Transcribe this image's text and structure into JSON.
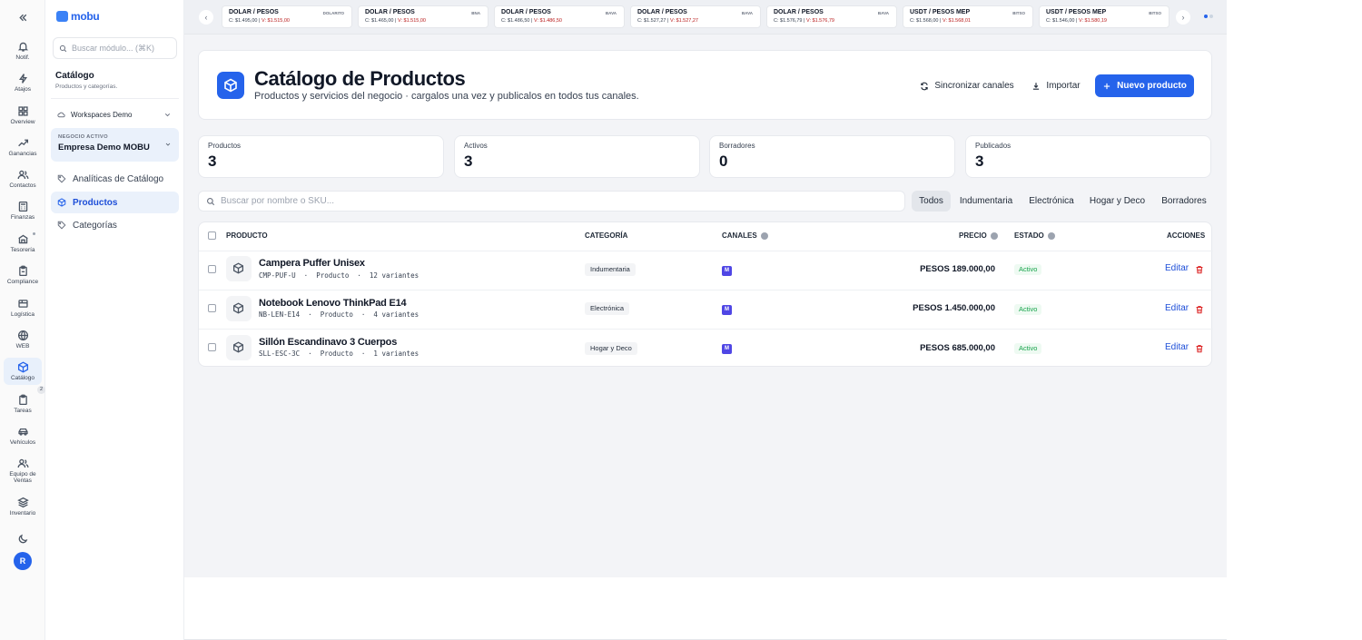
{
  "rail": {
    "collapse_icon": "chevrons-left-icon",
    "items": [
      {
        "label": "Notif.",
        "icon": "bell-icon"
      },
      {
        "label": "Atajos",
        "icon": "zap-icon"
      },
      {
        "label": "Overview",
        "icon": "grid-icon"
      },
      {
        "label": "Ganancias",
        "icon": "trending-up-icon"
      },
      {
        "label": "Contactos",
        "icon": "users-icon"
      },
      {
        "label": "Finanzas",
        "icon": "calculator-icon"
      },
      {
        "label": "Tesorería",
        "icon": "vault-icon"
      },
      {
        "label": "Compliance",
        "icon": "clipboard-icon"
      },
      {
        "label": "Logística",
        "icon": "package-icon"
      },
      {
        "label": "WEB",
        "icon": "globe-icon"
      },
      {
        "label": "Catálogo",
        "icon": "box-icon"
      },
      {
        "label": "Tareas",
        "icon": "clipboard-list-icon"
      },
      {
        "label": "Vehículos",
        "icon": "car-icon"
      },
      {
        "label": "Equipo de Ventas",
        "icon": "team-icon"
      },
      {
        "label": "Inventario",
        "icon": "layers-icon"
      }
    ],
    "catalog_badge": "2",
    "avatar_initial": "R"
  },
  "sidebar": {
    "brand": "mobu",
    "search_placeholder": "Buscar módulo... (⌘K)",
    "title": "Catálogo",
    "subtitle": "Productos y categorías.",
    "workspace": "Workspaces Demo",
    "business_label": "NEGOCIO ACTIVO",
    "business_name": "Empresa Demo MOBU",
    "nav": [
      {
        "label": "Analíticas de Catálogo",
        "icon": "tag-icon"
      },
      {
        "label": "Productos",
        "icon": "box-icon"
      },
      {
        "label": "Categorías",
        "icon": "tag-icon"
      }
    ]
  },
  "ticker": [
    {
      "pair": "DOLAR / PESOS",
      "source": "DOLARITO",
      "buy": "C: $1.495,00",
      "sell": "V: $1.515,00"
    },
    {
      "pair": "DOLAR / PESOS",
      "source": "BNA",
      "buy": "C: $1.465,00",
      "sell": "V: $1.515,00"
    },
    {
      "pair": "DOLAR / PESOS",
      "source": "BAVA",
      "buy": "C: $1.486,50",
      "sell": "V: $1.486,50"
    },
    {
      "pair": "DOLAR / PESOS",
      "source": "BAVA",
      "buy": "C: $1.527,27",
      "sell": "V: $1.527,27"
    },
    {
      "pair": "DOLAR / PESOS",
      "source": "BAVA",
      "buy": "C: $1.576,79",
      "sell": "V: $1.576,79"
    },
    {
      "pair": "USDT / PESOS MEP",
      "source": "BITSO",
      "buy": "C: $1.568,00",
      "sell": "V: $1.568,01"
    },
    {
      "pair": "USDT / PESOS MEP",
      "source": "BITSO",
      "buy": "C: $1.546,00",
      "sell": "V: $1.580,19"
    }
  ],
  "header": {
    "title": "Catálogo de Productos",
    "subtitle": "Productos y servicios del negocio · cargalos una vez y publicalos en todos tus canales.",
    "sync_label": "Sincronizar canales",
    "import_label": "Importar",
    "new_label": "Nuevo producto"
  },
  "stats": [
    {
      "label": "Productos",
      "value": "3"
    },
    {
      "label": "Activos",
      "value": "3"
    },
    {
      "label": "Borradores",
      "value": "0"
    },
    {
      "label": "Publicados",
      "value": "3"
    }
  ],
  "search": {
    "placeholder": "Buscar por nombre o SKU..."
  },
  "filters": [
    "Todos",
    "Indumentaria",
    "Electrónica",
    "Hogar y Deco",
    "Borradores"
  ],
  "table": {
    "columns": {
      "product": "PRODUCTO",
      "category": "CATEGORÍA",
      "channels": "CANALES",
      "price": "PRECIO",
      "status": "ESTADO",
      "actions": "ACCIONES"
    },
    "rows": [
      {
        "name": "Campera Puffer Unisex",
        "meta": "CMP-PUF-U  ·  Producto  ·  12 variantes",
        "category": "Indumentaria",
        "channel": "M",
        "price": "PESOS 189.000,00",
        "status": "Activo",
        "edit": "Editar"
      },
      {
        "name": "Notebook Lenovo ThinkPad E14",
        "meta": "NB-LEN-E14  ·  Producto  ·  4 variantes",
        "category": "Electrónica",
        "channel": "M",
        "price": "PESOS 1.450.000,00",
        "status": "Activo",
        "edit": "Editar"
      },
      {
        "name": "Sillón Escandinavo 3 Cuerpos",
        "meta": "SLL-ESC-3C  ·  Producto  ·  1 variantes",
        "category": "Hogar y Deco",
        "channel": "M",
        "price": "PESOS 685.000,00",
        "status": "Activo",
        "edit": "Editar"
      }
    ]
  }
}
